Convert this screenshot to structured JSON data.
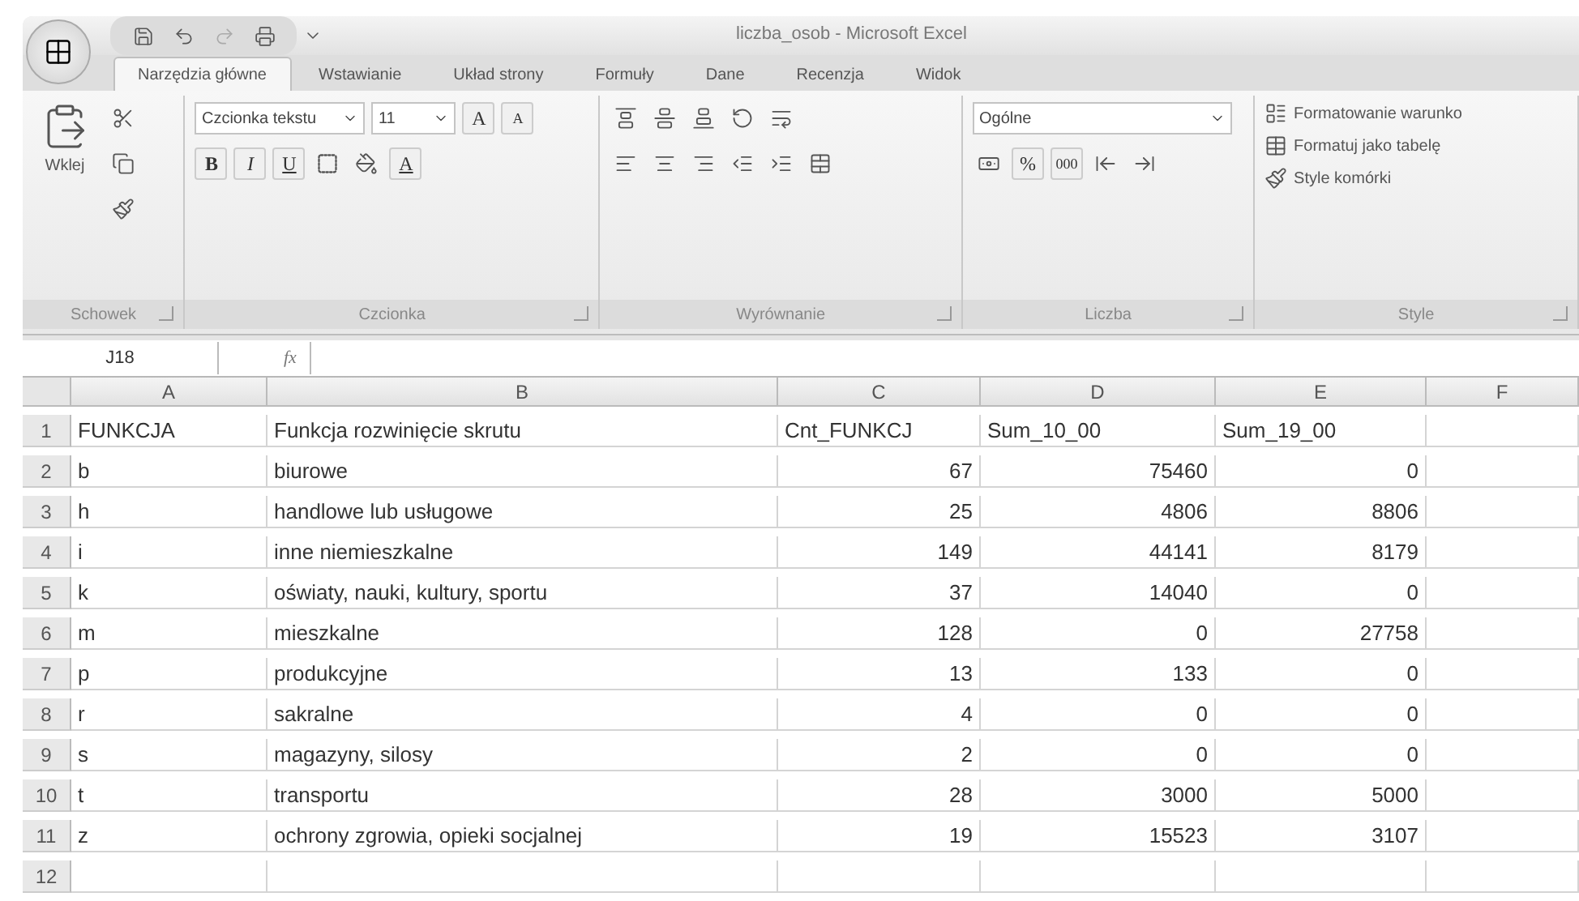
{
  "window": {
    "title": "liczba_osob - Microsoft Excel"
  },
  "tabs": [
    {
      "label": "Narzędzia główne",
      "selected": true
    },
    {
      "label": "Wstawianie",
      "selected": false
    },
    {
      "label": "Układ strony",
      "selected": false
    },
    {
      "label": "Formuły",
      "selected": false
    },
    {
      "label": "Dane",
      "selected": false
    },
    {
      "label": "Recenzja",
      "selected": false
    },
    {
      "label": "Widok",
      "selected": false
    }
  ],
  "ribbon": {
    "clipboard": {
      "label": "Schowek",
      "paste": "Wklej"
    },
    "font": {
      "label": "Czcionka",
      "name": "Czcionka tekstu",
      "size": "11",
      "grow": "A",
      "shrink": "A",
      "bold": "B",
      "italic": "I",
      "underline": "U",
      "font_color": "A"
    },
    "alignment": {
      "label": "Wyrównanie"
    },
    "number": {
      "label": "Liczba",
      "format": "Ogólne",
      "percent": "%",
      "thousands": "000"
    },
    "styles": {
      "label": "Style",
      "items": [
        "Formatowanie warunko",
        "Formatuj jako tabelę",
        "Style komórki"
      ]
    }
  },
  "formula_bar": {
    "name_box": "J18",
    "fx": "fx"
  },
  "sheet": {
    "columns": [
      "A",
      "B",
      "C",
      "D",
      "E",
      "F"
    ],
    "rows": [
      {
        "number": "1",
        "kind": "header",
        "cells": [
          "FUNKCJA",
          "Funkcja rozwinięcie skrutu",
          "Cnt_FUNKCJ",
          "Sum_10_00",
          "Sum_19_00"
        ]
      },
      {
        "number": "2",
        "kind": "data",
        "cells": [
          "b",
          "biurowe",
          "67",
          "75460",
          "0"
        ]
      },
      {
        "number": "3",
        "kind": "data",
        "cells": [
          "h",
          "handlowe lub usługowe",
          "25",
          "4806",
          "8806"
        ]
      },
      {
        "number": "4",
        "kind": "data",
        "cells": [
          "i",
          "inne niemieszkalne",
          "149",
          "44141",
          "8179"
        ]
      },
      {
        "number": "5",
        "kind": "data",
        "cells": [
          "k",
          "oświaty, nauki, kultury, sportu",
          "37",
          "14040",
          "0"
        ]
      },
      {
        "number": "6",
        "kind": "data",
        "cells": [
          "m",
          "mieszkalne",
          "128",
          "0",
          "27758"
        ]
      },
      {
        "number": "7",
        "kind": "data",
        "cells": [
          "p",
          "produkcyjne",
          "13",
          "133",
          "0"
        ]
      },
      {
        "number": "8",
        "kind": "data",
        "cells": [
          "r",
          "sakralne",
          "4",
          "0",
          "0"
        ]
      },
      {
        "number": "9",
        "kind": "data",
        "cells": [
          "s",
          "magazyny, silosy",
          "2",
          "0",
          "0"
        ]
      },
      {
        "number": "10",
        "kind": "data",
        "cells": [
          "t",
          "transportu",
          "28",
          "3000",
          "5000"
        ]
      },
      {
        "number": "11",
        "kind": "data",
        "cells": [
          "z",
          "ochrony zgrowia, opieki socjalnej",
          "19",
          "15523",
          "3107"
        ]
      },
      {
        "number": "12"
      }
    ]
  }
}
